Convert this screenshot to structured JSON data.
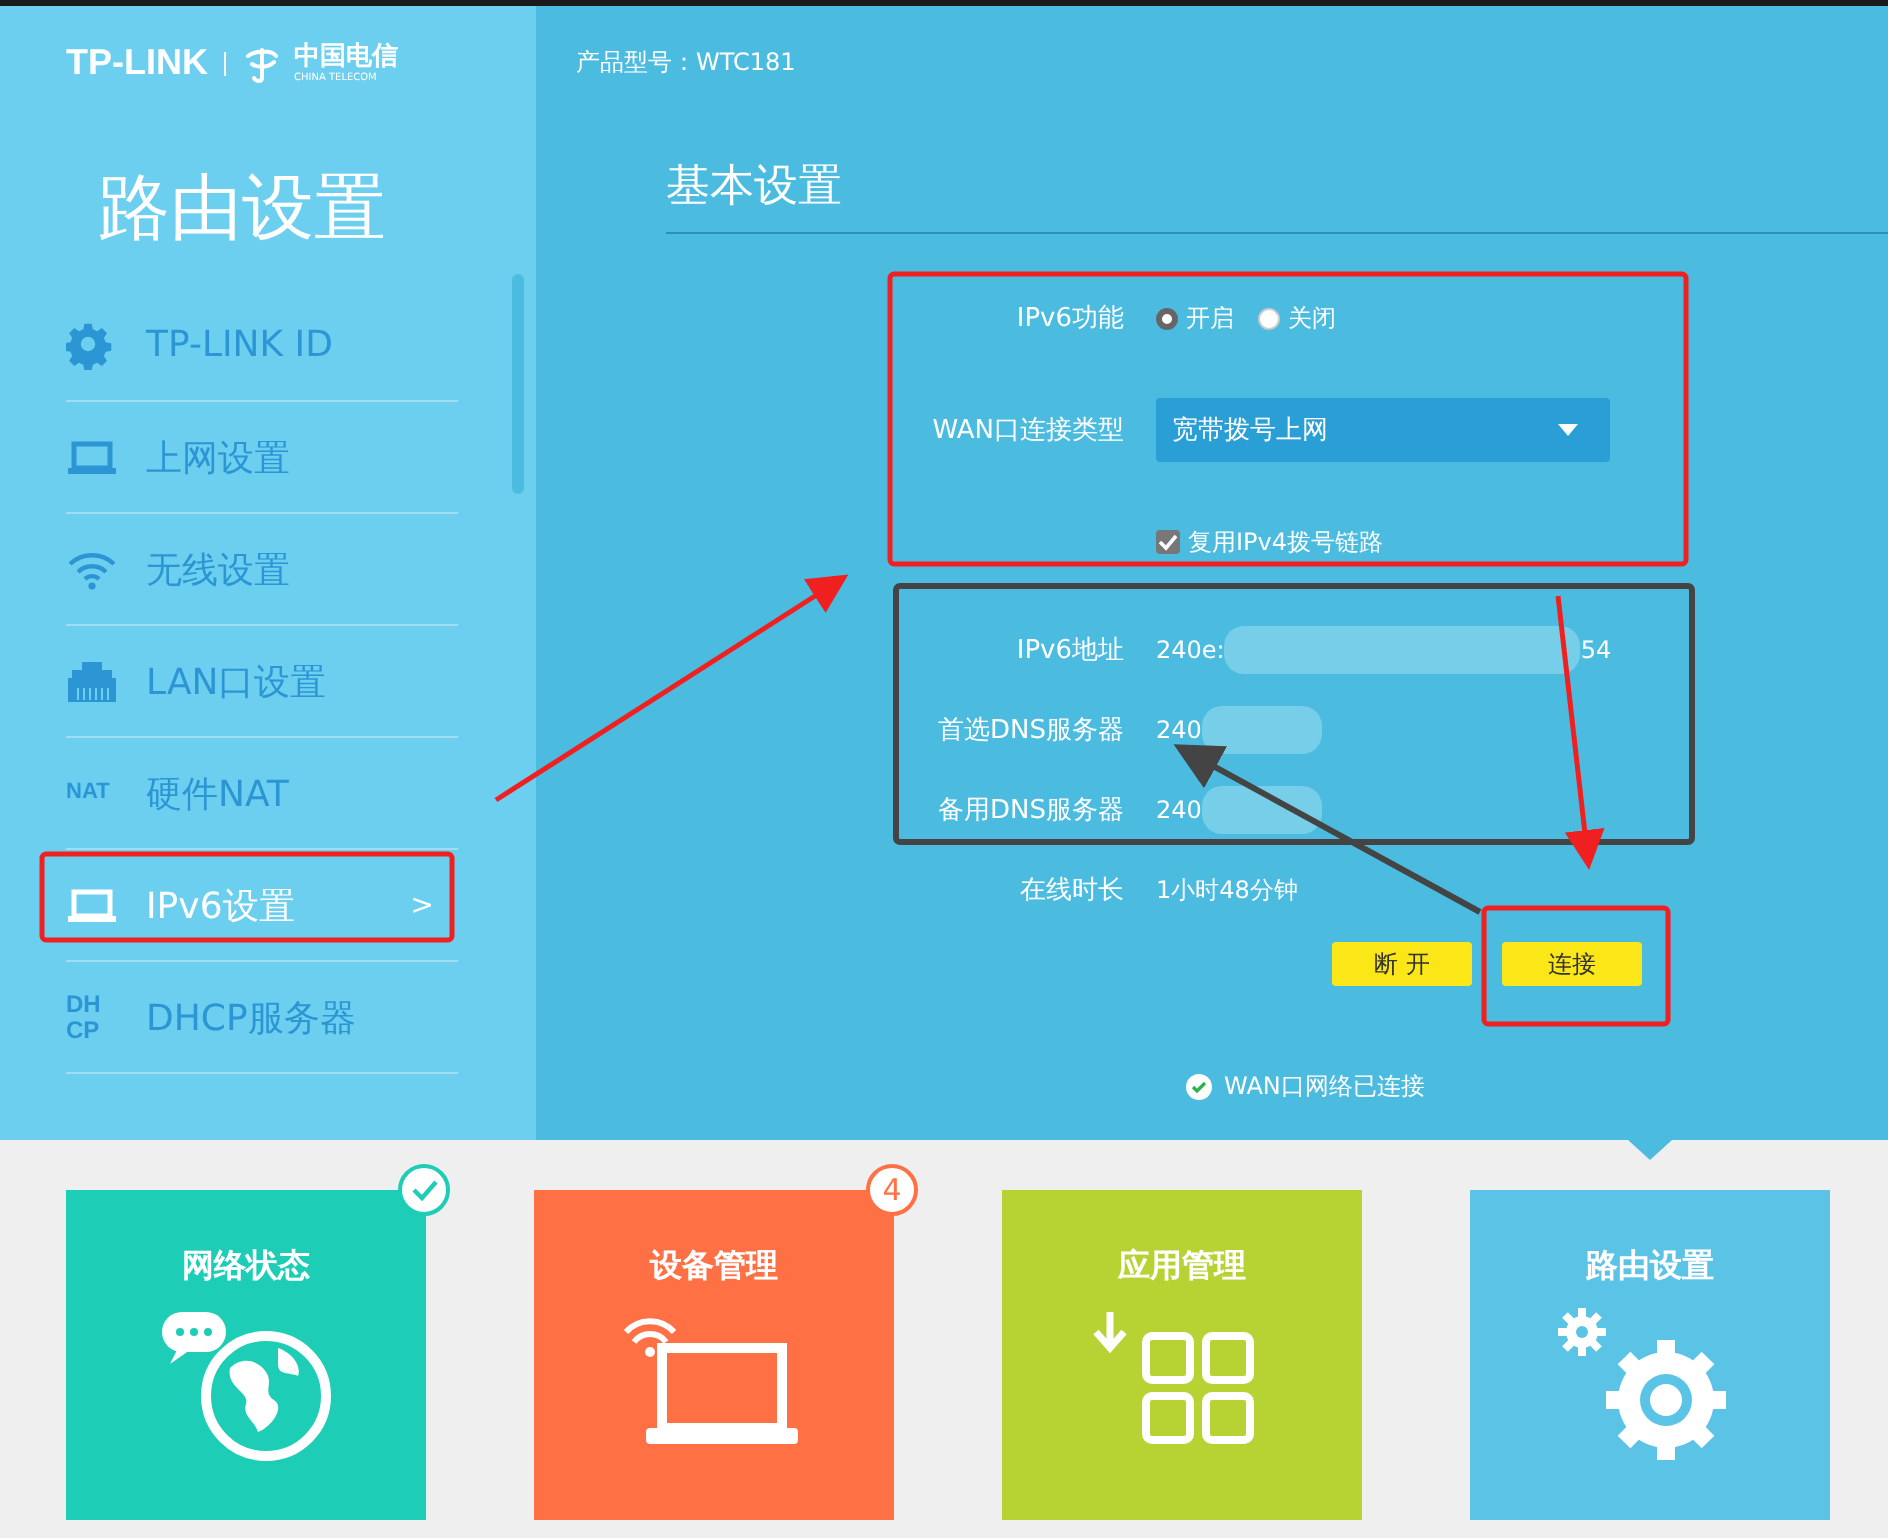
{
  "header": {
    "brand": "TP-LINK",
    "partner": "中国电信",
    "partner_sub": "CHINA TELECOM",
    "product_model": "产品型号：WTC181"
  },
  "sidebar": {
    "title": "路由设置",
    "items": [
      {
        "label": "TP-LINK ID",
        "kind": "gear",
        "selected": false
      },
      {
        "label": "上网设置",
        "kind": "laptop",
        "selected": false
      },
      {
        "label": "无线设置",
        "kind": "wifi",
        "selected": false
      },
      {
        "label": "LAN口设置",
        "kind": "lan",
        "selected": false
      },
      {
        "label": "硬件NAT",
        "kind": "nat",
        "icon_text": "NAT",
        "selected": false
      },
      {
        "label": "IPv6设置",
        "kind": "laptop",
        "selected": true,
        "chevron": ">"
      },
      {
        "label": "DHCP服务器",
        "kind": "dhcp",
        "icon_text": "DHCP",
        "selected": false
      }
    ]
  },
  "content": {
    "title": "基本设置",
    "ipv6_function": {
      "label": "IPv6功能",
      "options": [
        {
          "label": "开启",
          "selected": true
        },
        {
          "label": "关闭",
          "selected": false
        }
      ]
    },
    "wan_type": {
      "label": "WAN口连接类型",
      "value": "宽带拨号上网"
    },
    "reuse_ipv4": {
      "label": "复用IPv4拨号链路",
      "checked": true
    },
    "info": [
      {
        "label": "IPv6地址",
        "value": "240e:",
        "suffix": "54",
        "masked": true
      },
      {
        "label": "首选DNS服务器",
        "value": "240",
        "masked": true
      },
      {
        "label": "备用DNS服务器",
        "value": "240",
        "masked": true
      },
      {
        "label": "在线时长",
        "value": "1小时48分钟",
        "masked": false
      }
    ],
    "buttons": [
      "断 开",
      "连接"
    ],
    "status": "WAN口网络已连接"
  },
  "tiles": [
    {
      "label": "网络状态",
      "kind": "globe",
      "color": "#1dcdb6",
      "checked": true,
      "selected": false
    },
    {
      "label": "设备管理",
      "kind": "laptop",
      "color": "#ff7144",
      "checked": false,
      "count": "4",
      "selected": false
    },
    {
      "label": "应用管理",
      "kind": "apps",
      "color": "#b6d233",
      "checked": false,
      "selected": false
    },
    {
      "label": "路由设置",
      "kind": "gears",
      "color": "#5bc4e6",
      "checked": false,
      "selected": true
    }
  ]
}
